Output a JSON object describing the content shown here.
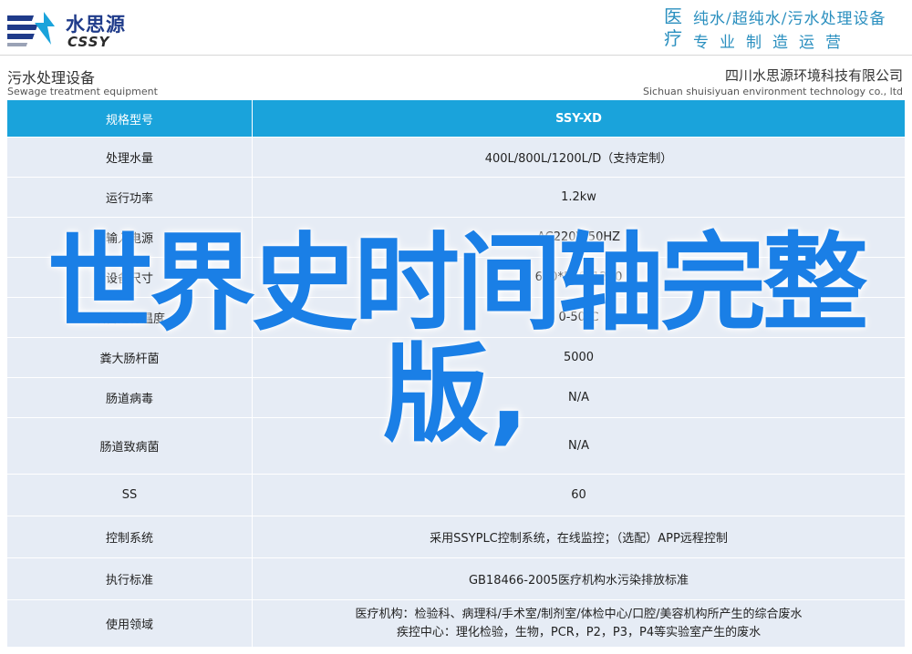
{
  "header": {
    "brand_cn": "水思源",
    "brand_en": "CSSY",
    "slogan_badge": "医疗",
    "slogan_line1": "纯水/超纯水/污水处理设备",
    "slogan_line2": "专业制造运营"
  },
  "subheader": {
    "left_cn": "污水处理设备",
    "left_en": "Sewage treatment equipment",
    "right_cn": "四川水思源环境科技有限公司",
    "right_en": "Sichuan shuisiyuan environment technology co., ltd"
  },
  "table": {
    "head": {
      "key": "规格型号",
      "value": "SSY-XD"
    },
    "rows": [
      {
        "key": "处理水量",
        "value": "400L/800L/1200L/D（支持定制）"
      },
      {
        "key": "运行功率",
        "value": "1.2kw"
      },
      {
        "key": "输入电源",
        "value": "AC220V/50HZ"
      },
      {
        "key": "设备尺寸",
        "value": "600*560*1200"
      },
      {
        "key": "设备运行温度",
        "value": "0-50℃"
      },
      {
        "key": "粪大肠杆菌",
        "value": "5000"
      },
      {
        "key": "肠道病毒",
        "value": "N/A"
      },
      {
        "key": "肠道致病菌",
        "value": "N/A"
      },
      {
        "key": "SS",
        "value": "60"
      },
      {
        "key": "控制系统",
        "value": "采用SSYPLC控制系统，在线监控；（选配）APP远程控制"
      },
      {
        "key": "执行标准",
        "value": "GB18466-2005医疗机构水污染排放标准"
      },
      {
        "key": "使用领域",
        "value_line1": "医疗机构：检验科、病理科/手术室/制剂室/体检中心/口腔/美容机构所产生的综合废水",
        "value_line2": "疾控中心：理化检验，生物，PCR，P2，P3，P4等实验室产生的废水"
      }
    ]
  },
  "overlay": {
    "line1": "世界史时间轴完整",
    "line2": "版,"
  },
  "colors": {
    "header_row": "#1aa3db",
    "body_row": "#e6ecf5",
    "overlay_text": "#1a7fe6",
    "brand": "#1f3b8a",
    "slogan": "#2a8fbf"
  }
}
